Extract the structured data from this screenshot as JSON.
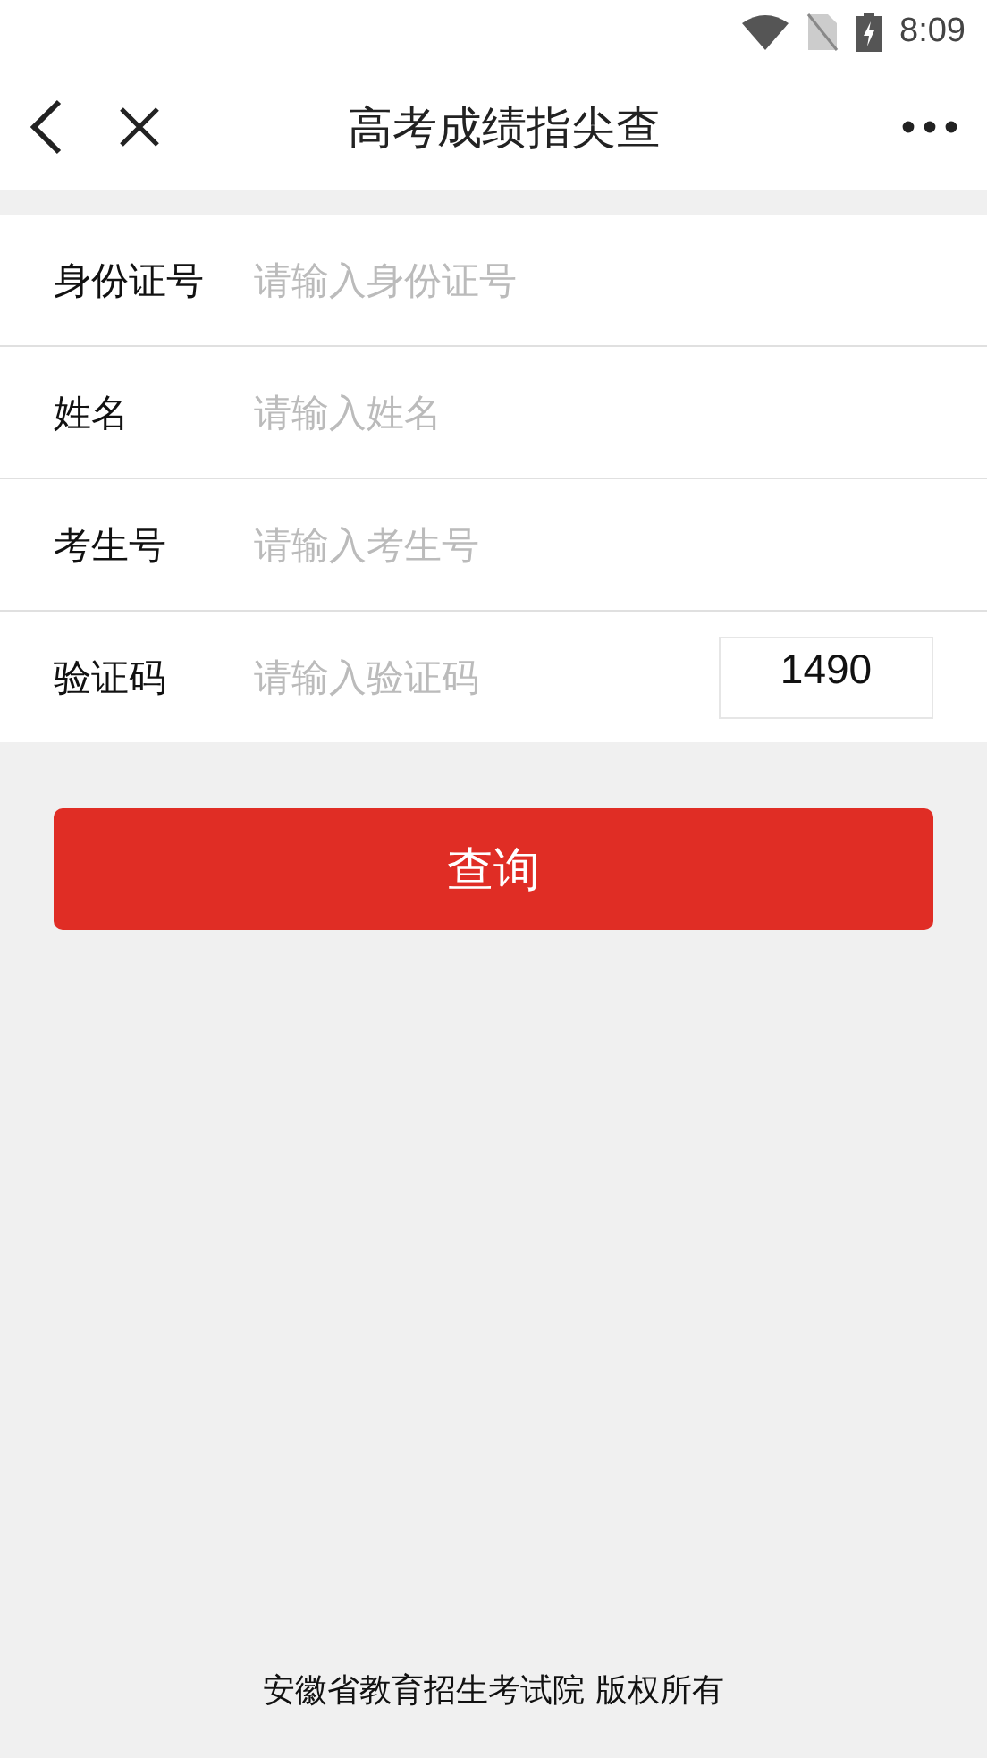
{
  "status_bar": {
    "time": "8:09"
  },
  "nav_bar": {
    "title": "高考成绩指尖查"
  },
  "form": {
    "fields": [
      {
        "label": "身份证号",
        "placeholder": "请输入身份证号",
        "kind": "text"
      },
      {
        "label": "姓名",
        "placeholder": "请输入姓名",
        "kind": "text"
      },
      {
        "label": "考生号",
        "placeholder": "请输入考生号",
        "kind": "text"
      },
      {
        "label": "验证码",
        "placeholder": "请输入验证码",
        "kind": "captcha",
        "captcha": "1490"
      }
    ]
  },
  "submit_button": "查询",
  "footer": "安徽省教育招生考试院 版权所有"
}
